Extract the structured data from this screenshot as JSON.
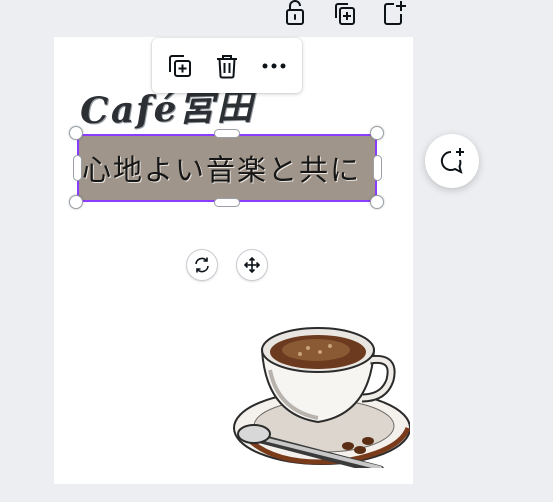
{
  "top_actions": {
    "items": [
      {
        "icon": "lock-icon",
        "action": "lock"
      },
      {
        "icon": "duplicate-page-icon",
        "action": "duplicate-page"
      },
      {
        "icon": "add-page-icon",
        "action": "add-page"
      }
    ]
  },
  "floating_toolbar": {
    "items": [
      {
        "icon": "duplicate-icon",
        "action": "duplicate"
      },
      {
        "icon": "trash-icon",
        "action": "delete"
      },
      {
        "icon": "more-icon",
        "action": "more"
      }
    ]
  },
  "canvas": {
    "title": "Café宮田",
    "selected_text": "心地よい音楽と共に",
    "image": "coffee-cup-illustration"
  },
  "controls": {
    "rotate_icon": "rotate-icon",
    "move_icon": "move-icon",
    "comment_icon": "add-comment-icon"
  },
  "colors": {
    "selection": "#8b3dff",
    "text_box_fill": "#9f958a",
    "workspace": "#eceef1"
  }
}
